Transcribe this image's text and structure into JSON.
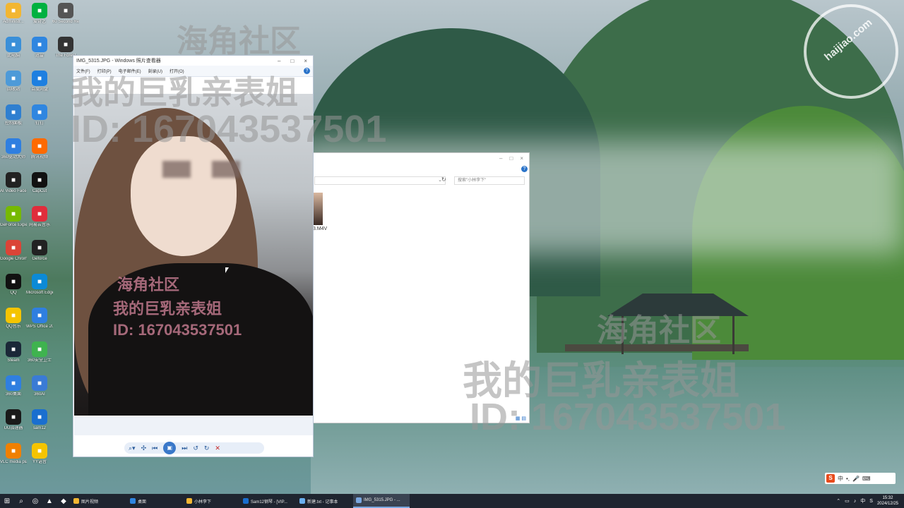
{
  "desktop": {
    "icons": [
      {
        "label": "Administr...",
        "icon": "user-folder-icon",
        "color": "#f2b632"
      },
      {
        "label": "此电脑",
        "icon": "computer-icon",
        "color": "#3a8fd8"
      },
      {
        "label": "回收站",
        "icon": "recycle-bin-icon",
        "color": "#4d9ad8"
      },
      {
        "label": "控制面板",
        "icon": "control-panel-icon",
        "color": "#2f7fd0"
      },
      {
        "label": "360驱动大师",
        "icon": "driver-icon",
        "color": "#2f7fe0"
      },
      {
        "label": "AI Video FaceSwap",
        "icon": "faceswap-icon",
        "color": "#222222"
      },
      {
        "label": "GeForce Experience",
        "icon": "nvidia-icon",
        "color": "#76b900"
      },
      {
        "label": "Google Chrome",
        "icon": "chrome-icon",
        "color": "#db4437"
      },
      {
        "label": "QQ",
        "icon": "qq-icon",
        "color": "#111111"
      },
      {
        "label": "QQ音乐",
        "icon": "qq-music-icon",
        "color": "#f5c400"
      },
      {
        "label": "Steam",
        "icon": "steam-icon",
        "color": "#1b2838"
      },
      {
        "label": "360桌面",
        "icon": "desktop-icon",
        "color": "#2f7fe0"
      },
      {
        "label": "UU加速器",
        "icon": "uu-icon",
        "color": "#1a1a1a"
      },
      {
        "label": "VLC media player",
        "icon": "vlc-icon",
        "color": "#f08000"
      },
      {
        "label": "爱奇艺",
        "icon": "iqiyi-icon",
        "color": "#00b140"
      },
      {
        "label": "迅雷",
        "icon": "thunder-icon",
        "color": "#2f86e0"
      },
      {
        "label": "百度网盘",
        "icon": "netdisk-icon",
        "color": "#1e7fe0"
      },
      {
        "label": "钉钉",
        "icon": "dingtalk-icon",
        "color": "#2f86e0"
      },
      {
        "label": "腾讯视频",
        "icon": "tencent-video-icon",
        "color": "#ff6a00"
      },
      {
        "label": "CapCut",
        "icon": "capcut-icon",
        "color": "#111111"
      },
      {
        "label": "网易云音乐",
        "icon": "music-icon",
        "color": "#e02d3c"
      },
      {
        "label": "Geforce",
        "icon": "geforce-icon",
        "color": "#222222"
      },
      {
        "label": "Microsoft Edge",
        "icon": "edge-icon",
        "color": "#0c8ad6"
      },
      {
        "label": "WPS Office 2019",
        "icon": "wps-icon",
        "color": "#2f7fe0"
      },
      {
        "label": "360安全卫士",
        "icon": "security-icon",
        "color": "#3fb34f"
      },
      {
        "label": "360AI",
        "icon": "ai-icon",
        "color": "#3a7bd5"
      },
      {
        "label": "sam12",
        "icon": "sam-icon",
        "color": "#1a6fcf"
      },
      {
        "label": "YY语音",
        "icon": "yy-icon",
        "color": "#f5c400"
      },
      {
        "label": "60 Second Reckoning",
        "icon": "game-icon",
        "color": "#555555"
      },
      {
        "label": "The Forest",
        "icon": "forest-icon",
        "color": "#333333"
      }
    ]
  },
  "watermarks": {
    "big_line1": "海角社区",
    "big_line2": "我的巨乳亲表姐",
    "big_line3": "ID: 167043537501",
    "pink_line1": "海角社区",
    "pink_line2": "我的巨乳亲表姐",
    "pink_line3": "ID: 167043537501",
    "logo_domain": "haijiao.com",
    "logo_name": "海角社区"
  },
  "explorer": {
    "search_placeholder": "搜索\"小林李下\"",
    "file_name": "3.M4V",
    "help": "?"
  },
  "viewer": {
    "title": "IMG_5315.JPG - Windows 照片查看器",
    "menu": [
      "文件(F)",
      "打印(P)",
      "电子邮件(E)",
      "刻录(U)",
      "打开(O)"
    ],
    "help": "?"
  },
  "taskbar": {
    "tasks": [
      {
        "label": "图片视频",
        "color": "#f2b632",
        "active": false
      },
      {
        "label": "桌面",
        "color": "#2f86e0",
        "active": false
      },
      {
        "label": "小林李下",
        "color": "#f2b632",
        "active": false
      },
      {
        "label": "Sam12钢琴 - [VIP...",
        "color": "#1a6fcf",
        "active": false
      },
      {
        "label": "新建.txt - 记事本",
        "color": "#6ab0f0",
        "active": false
      },
      {
        "label": "IMG_5315.JPG - ...",
        "color": "#7aa7e0",
        "active": true
      }
    ],
    "time": "15:32",
    "date": "2024/12/25"
  },
  "ime": {
    "logo": "S",
    "mode": "中"
  }
}
